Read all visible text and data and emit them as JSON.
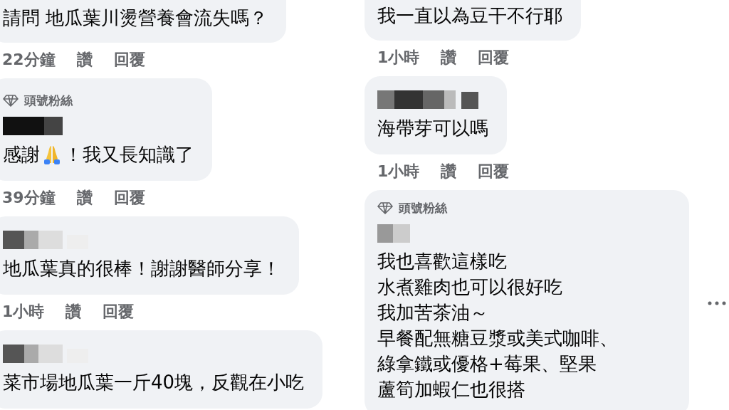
{
  "columns": [
    {
      "comments": [
        {
          "name_blurred": false,
          "lines": [
            "請問 地瓜葉川燙營養會流失嗎？"
          ],
          "meta": {
            "time": "22分鐘",
            "like": "讚",
            "reply": "回覆"
          }
        },
        {
          "badge": "頭號粉絲",
          "name_blurred": true,
          "lines": [
            [
              {
                "kind": "text",
                "text": "感謝"
              },
              {
                "kind": "praying-hands"
              },
              {
                "kind": "text",
                "text": "！我又長知識了"
              }
            ]
          ],
          "meta": {
            "time": "39分鐘",
            "like": "讚",
            "reply": "回覆"
          }
        },
        {
          "name_blurred": true,
          "lines": [
            "地瓜葉真的很棒！謝謝醫師分享！"
          ],
          "meta": {
            "time": "1小時",
            "like": "讚",
            "reply": "回覆"
          }
        },
        {
          "name_blurred": true,
          "lines": [
            "菜市場地瓜葉一斤40塊，反觀在小吃"
          ]
        }
      ]
    },
    {
      "comments": [
        {
          "name_blurred": false,
          "lines": [
            "我一直以為豆干不行耶"
          ],
          "meta": {
            "time": "1小時",
            "like": "讚",
            "reply": "回覆"
          }
        },
        {
          "name_blurred": true,
          "lines": [
            "海帶芽可以嗎"
          ],
          "meta": {
            "time": "1小時",
            "like": "讚",
            "reply": "回覆"
          }
        },
        {
          "badge": "頭號粉絲",
          "name_blurred": true,
          "more_button": true,
          "lines": [
            "我也喜歡這樣吃",
            "水煮雞肉也可以很好吃",
            "我加苦茶油～",
            "早餐配無糖豆漿或美式咖啡、",
            "綠拿鐵或優格+莓果、堅果",
            "蘆筍加蝦仁也很搭"
          ]
        }
      ]
    }
  ]
}
